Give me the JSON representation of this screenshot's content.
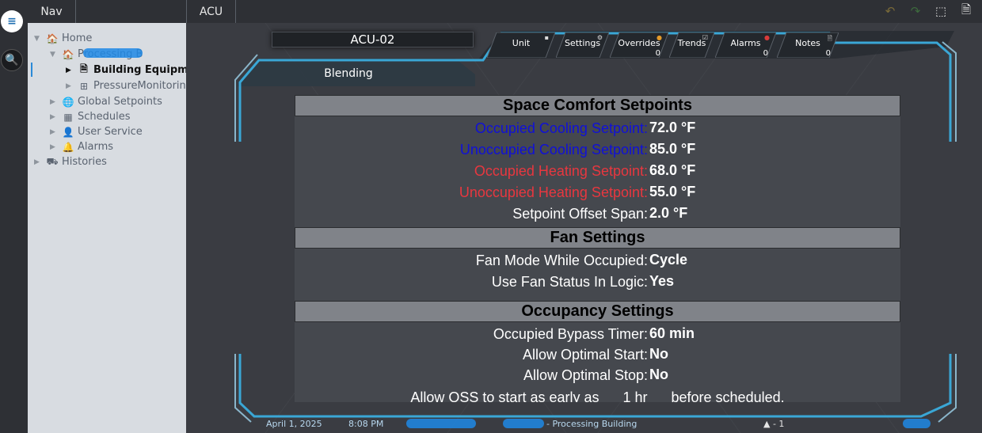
{
  "rail": {
    "menu_icon": "≡",
    "search_icon": "🔍"
  },
  "nav": {
    "tab_label": "Nav",
    "tree": [
      {
        "id": "home",
        "label": "Home",
        "icon": "house-icon",
        "glyph": "🏠",
        "twisty": "▼",
        "bold": false
      },
      {
        "id": "processing",
        "label": "Processing B",
        "icon": "house-red-icon",
        "glyph": "🏠",
        "twisty": "▼",
        "bold": false
      },
      {
        "id": "building-equipment",
        "label": "Building Equipmen",
        "icon": "document-icon",
        "glyph": "🗎",
        "twisty": "▶",
        "bold": true
      },
      {
        "id": "pressure-monitoring",
        "label": "PressureMonitoring",
        "icon": "grid-icon",
        "glyph": "⊞",
        "twisty": "▶",
        "bold": false
      },
      {
        "id": "global-setpoints",
        "label": "Global Setpoints",
        "icon": "globe-icon",
        "glyph": "🌐",
        "twisty": "▶",
        "bold": false
      },
      {
        "id": "schedules",
        "label": "Schedules",
        "icon": "calendar-icon",
        "glyph": "▦",
        "twisty": "▶",
        "bold": false
      },
      {
        "id": "user-service",
        "label": "User Service",
        "icon": "user-icon",
        "glyph": "👤",
        "twisty": "▶",
        "bold": false
      },
      {
        "id": "alarms",
        "label": "Alarms",
        "icon": "bell-icon",
        "glyph": "🔔",
        "twisty": "▶",
        "bold": false
      },
      {
        "id": "histories",
        "label": "Histories",
        "icon": "histories-icon",
        "glyph": "⛟",
        "twisty": "▶",
        "bold": false
      }
    ]
  },
  "header": {
    "tab_label": "ACU",
    "icons": {
      "undo": "↶",
      "redo": "↷",
      "select": "⬚",
      "export": "🗎"
    }
  },
  "screen": {
    "title": "ACU-02",
    "view_label": "Blending",
    "tabs": [
      {
        "label": "Unit",
        "count": "",
        "mark": "▪"
      },
      {
        "label": "Settings",
        "count": "",
        "mark": "⚙"
      },
      {
        "label": "Overrides",
        "count": "0",
        "mark": "●"
      },
      {
        "label": "Trends",
        "count": "",
        "mark": "☑"
      },
      {
        "label": "Alarms",
        "count": "0",
        "mark": "●"
      },
      {
        "label": "Notes",
        "count": "0",
        "mark": "🗎"
      }
    ]
  },
  "colors": {
    "cooling": "#1010d8",
    "heating": "#e8373f",
    "normal": "#ffffff",
    "accent": "#3aa7d6"
  },
  "sections": {
    "comfort": {
      "title": "Space Comfort Setpoints",
      "rows": [
        {
          "label": "Occupied Cooling Setpoint:",
          "value": "72.0 °F",
          "kind": "cooling"
        },
        {
          "label": "Unoccupied Cooling Setpoint:",
          "value": "85.0 °F",
          "kind": "cooling"
        },
        {
          "label": "Occupied Heating Setpoint:",
          "value": "68.0 °F",
          "kind": "heating"
        },
        {
          "label": "Unoccupied Heating Setpoint:",
          "value": "55.0 °F",
          "kind": "heating"
        },
        {
          "label": "Setpoint Offset Span:",
          "value": "2.0 °F",
          "kind": "normal"
        }
      ]
    },
    "fan": {
      "title": "Fan Settings",
      "rows": [
        {
          "label": "Fan Mode While Occupied:",
          "value": "Cycle",
          "kind": "normal"
        },
        {
          "label": "Use Fan Status In Logic:",
          "value": "Yes",
          "kind": "normal"
        }
      ]
    },
    "occupancy": {
      "title": "Occupancy Settings",
      "rows": [
        {
          "label": "Occupied Bypass Timer:",
          "value": "60 min",
          "kind": "normal"
        },
        {
          "label": "Allow Optimal Start:",
          "value": "No",
          "kind": "normal"
        },
        {
          "label": "Allow Optimal Stop:",
          "value": "No",
          "kind": "normal"
        }
      ],
      "oss_text": "Allow OSS to start as early as      1 hr      before scheduled."
    }
  },
  "status": {
    "date": "April 1, 2025",
    "time": "8:08 PM",
    "building": "- Processing Building",
    "alarm_count": "▲ - 1"
  }
}
